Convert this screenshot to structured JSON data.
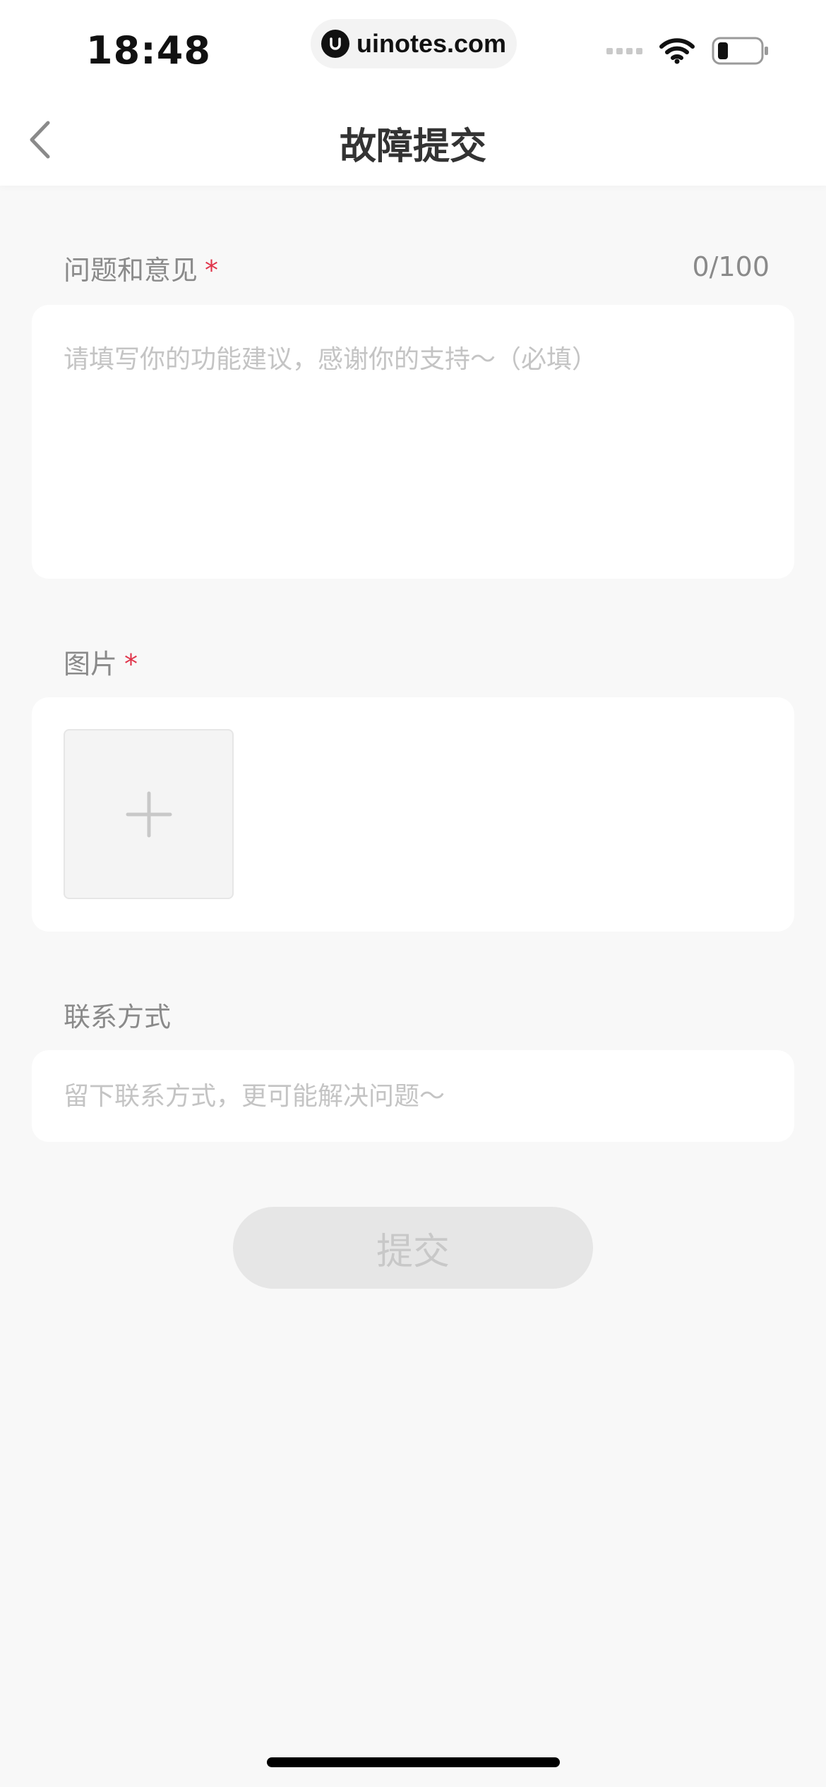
{
  "status_bar": {
    "time": "18:48",
    "watermark": "uinotes.com"
  },
  "nav": {
    "title": "故障提交"
  },
  "feedback": {
    "label": "问题和意见",
    "required_mark": "*",
    "counter": "0/100",
    "placeholder": "请填写你的功能建议，感谢你的支持～（必填）"
  },
  "image": {
    "label": "图片",
    "required_mark": "*"
  },
  "contact": {
    "label": "联系方式",
    "placeholder": "留下联系方式，更可能解决问题～"
  },
  "submit": {
    "label": "提交"
  },
  "icons": {
    "back": "chevron-left-icon",
    "add": "plus-icon",
    "signal": "signal-icon",
    "wifi": "wifi-icon",
    "battery": "battery-icon"
  },
  "colors": {
    "required": "#e0344a",
    "background": "#f8f8f8",
    "button_disabled": "#e6e6e6"
  }
}
